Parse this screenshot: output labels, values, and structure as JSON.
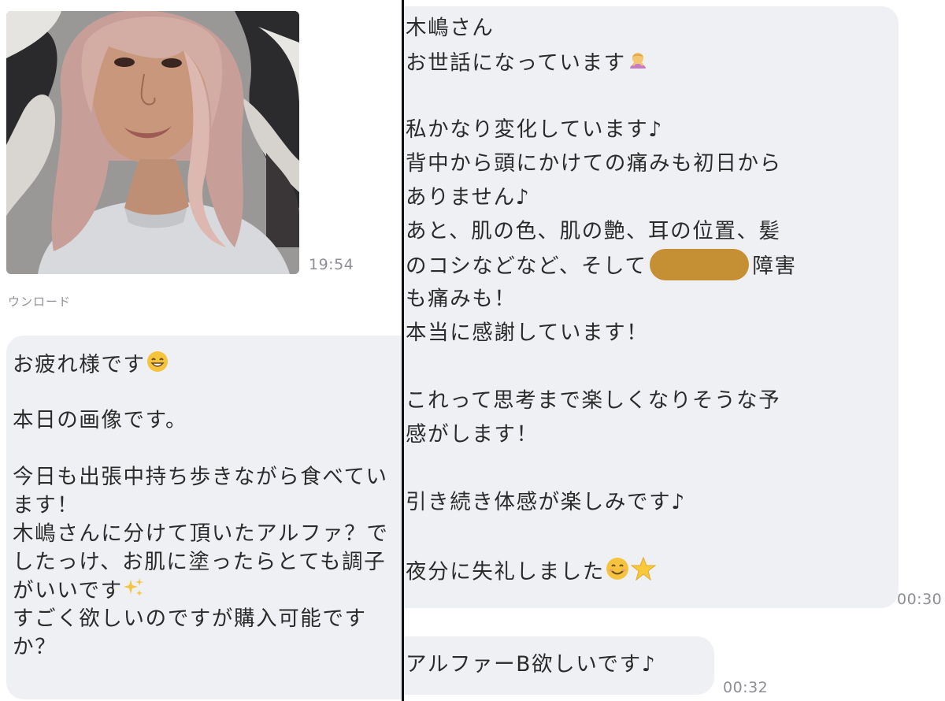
{
  "left_chat": {
    "photo": {
      "alt": ""
    },
    "photo_time": "19:54",
    "download_label": "ウンロード",
    "message": {
      "lines": [
        "お疲れ様です",
        "",
        "本日の画像です。",
        "",
        "今日も出張中持ち歩きながら食べてい",
        "ます！",
        "木嶋さんに分けて頂いたアルファ？で",
        "したっけ、お肌に塗ったらとても調子",
        "がいいです",
        "すごく欲しいのですが購入可能です",
        "か？"
      ],
      "emojis": {
        "line_1": "grinning-face-emoji",
        "line_9": "sparkles-emoji"
      }
    }
  },
  "right_chat": {
    "message_main": {
      "lines": [
        "木嶋さん",
        "お世話になっています",
        "",
        "私かなり変化しています♪",
        "背中から頭にかけての痛みも初日から",
        "ありません♪",
        "あと、肌の色、肌の艶、耳の位置、髪",
        "のコシなどなど、そして",
        "障害",
        "も痛みも！",
        "本当に感謝しています！",
        "",
        "これって思考まで楽しくなりそうな予",
        "感がします！",
        "",
        "引き続き体感が楽しみです♪",
        "",
        "夜分に失礼しました"
      ],
      "emojis": {
        "line_2": "person-bowing-emoji",
        "line_18": [
          "smiling-face-emoji",
          "star-emoji"
        ]
      },
      "redaction_color": "#c58f34",
      "time": "00:30"
    },
    "message_small": {
      "text": "アルファーB欲しいです♪",
      "time": "00:32"
    }
  },
  "colors": {
    "bubble": "#eef0f3",
    "text": "#2b2b2b",
    "timestamp": "#8d8f94",
    "divider": "#111111"
  }
}
